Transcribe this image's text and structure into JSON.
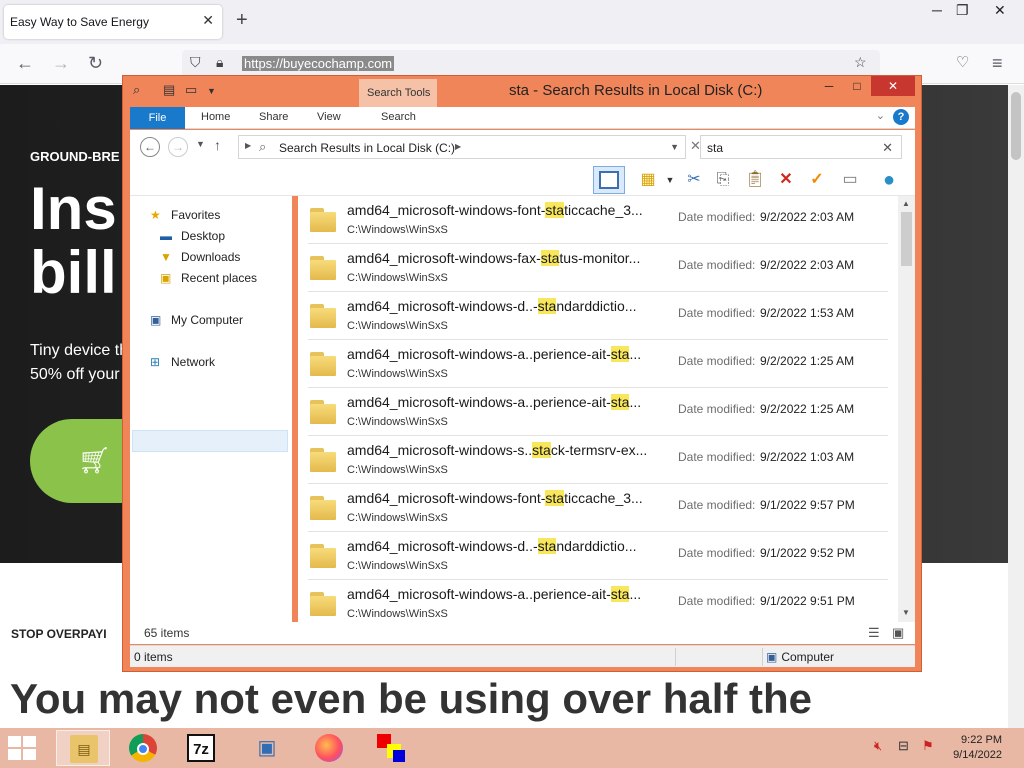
{
  "browser": {
    "tab_title": "Easy Way to Save Energy",
    "tab_close": "✕",
    "new_tab": "+",
    "url": "https://buyecochamp.com",
    "window_controls": [
      "─",
      "❐",
      "✕"
    ]
  },
  "webpage": {
    "eyebrow": "GROUND-BRE",
    "title_line1": "Ins",
    "title_line2": "bill",
    "subtitle_line1": "Tiny device th",
    "subtitle_line2": "50% off your",
    "stop_text": "STOP OVERPAYI",
    "headline": "You may not even be using over half the"
  },
  "explorer": {
    "title": "sta - Search Results in Local Disk (C:)",
    "search_tools": "Search Tools",
    "ribbon_tabs": [
      "File",
      "Home",
      "Share",
      "View",
      "Search"
    ],
    "address": "Search Results in Local Disk (C:)",
    "search_query": "sta",
    "nav": {
      "favorites": "Favorites",
      "desktop": "Desktop",
      "downloads": "Downloads",
      "recent": "Recent places",
      "computer": "My Computer",
      "network": "Network"
    },
    "date_label": "Date modified:",
    "files": [
      {
        "pre": "amd64_microsoft-windows-font-",
        "hit": "sta",
        "post": "ticcache_3...",
        "path": "C:\\Windows\\WinSxS",
        "date": "9/2/2022 2:03 AM"
      },
      {
        "pre": "amd64_microsoft-windows-fax-",
        "hit": "sta",
        "post": "tus-monitor...",
        "path": "C:\\Windows\\WinSxS",
        "date": "9/2/2022 2:03 AM"
      },
      {
        "pre": "amd64_microsoft-windows-d..-",
        "hit": "sta",
        "post": "ndarddictio...",
        "path": "C:\\Windows\\WinSxS",
        "date": "9/2/2022 1:53 AM"
      },
      {
        "pre": "amd64_microsoft-windows-a..perience-ait-",
        "hit": "sta",
        "post": "...",
        "path": "C:\\Windows\\WinSxS",
        "date": "9/2/2022 1:25 AM"
      },
      {
        "pre": "amd64_microsoft-windows-a..perience-ait-",
        "hit": "sta",
        "post": "...",
        "path": "C:\\Windows\\WinSxS",
        "date": "9/2/2022 1:25 AM"
      },
      {
        "pre": "amd64_microsoft-windows-s..",
        "hit": "sta",
        "post": "ck-termsrv-ex...",
        "path": "C:\\Windows\\WinSxS",
        "date": "9/2/2022 1:03 AM"
      },
      {
        "pre": "amd64_microsoft-windows-font-",
        "hit": "sta",
        "post": "ticcache_3...",
        "path": "C:\\Windows\\WinSxS",
        "date": "9/1/2022 9:57 PM"
      },
      {
        "pre": "amd64_microsoft-windows-d..-",
        "hit": "sta",
        "post": "ndarddictio...",
        "path": "C:\\Windows\\WinSxS",
        "date": "9/1/2022 9:52 PM"
      },
      {
        "pre": "amd64_microsoft-windows-a..perience-ait-",
        "hit": "sta",
        "post": "...",
        "path": "C:\\Windows\\WinSxS",
        "date": "9/1/2022 9:51 PM"
      }
    ],
    "item_count": "65 items",
    "status_left": "0 items",
    "status_location": "Computer"
  },
  "taskbar": {
    "time": "9:22 PM",
    "date": "9/14/2022",
    "sevenzip_label": "7z"
  },
  "colors": {
    "window_frame": "#f0855a",
    "highlight": "#f8e75a",
    "file_tab": "#1979ca",
    "taskbar": "#e8b8a4"
  }
}
